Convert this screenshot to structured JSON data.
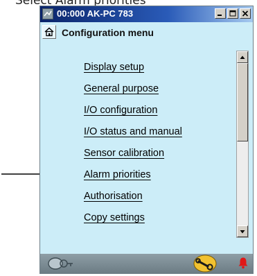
{
  "caption": "Select Alarm priorities",
  "window": {
    "title": "00:000 AK-PC 783",
    "controls": {
      "minimize": "_",
      "maximize": "□",
      "close": "×"
    }
  },
  "header": {
    "title": "Configuration menu",
    "icon": "home-icon"
  },
  "menu": {
    "items": [
      {
        "label": "Display setup"
      },
      {
        "label": "General purpose"
      },
      {
        "label": "I/O configuration"
      },
      {
        "label": "I/O status and manual"
      },
      {
        "label": "Sensor calibration"
      },
      {
        "label": "Alarm priorities"
      },
      {
        "label": "Authorisation"
      },
      {
        "label": "Copy settings"
      }
    ],
    "highlighted_item": "Alarm priorities"
  },
  "statusbar": {
    "icons": [
      "login-key-icon",
      "service-wrench-icon",
      "alarm-bell-icon"
    ]
  },
  "colors": {
    "title_bar": "#0a246a",
    "background": "#ccedf8",
    "status_bar": "#7a8a92",
    "wrench_badge": "#f2c230",
    "alarm_bell": "#e01818"
  }
}
